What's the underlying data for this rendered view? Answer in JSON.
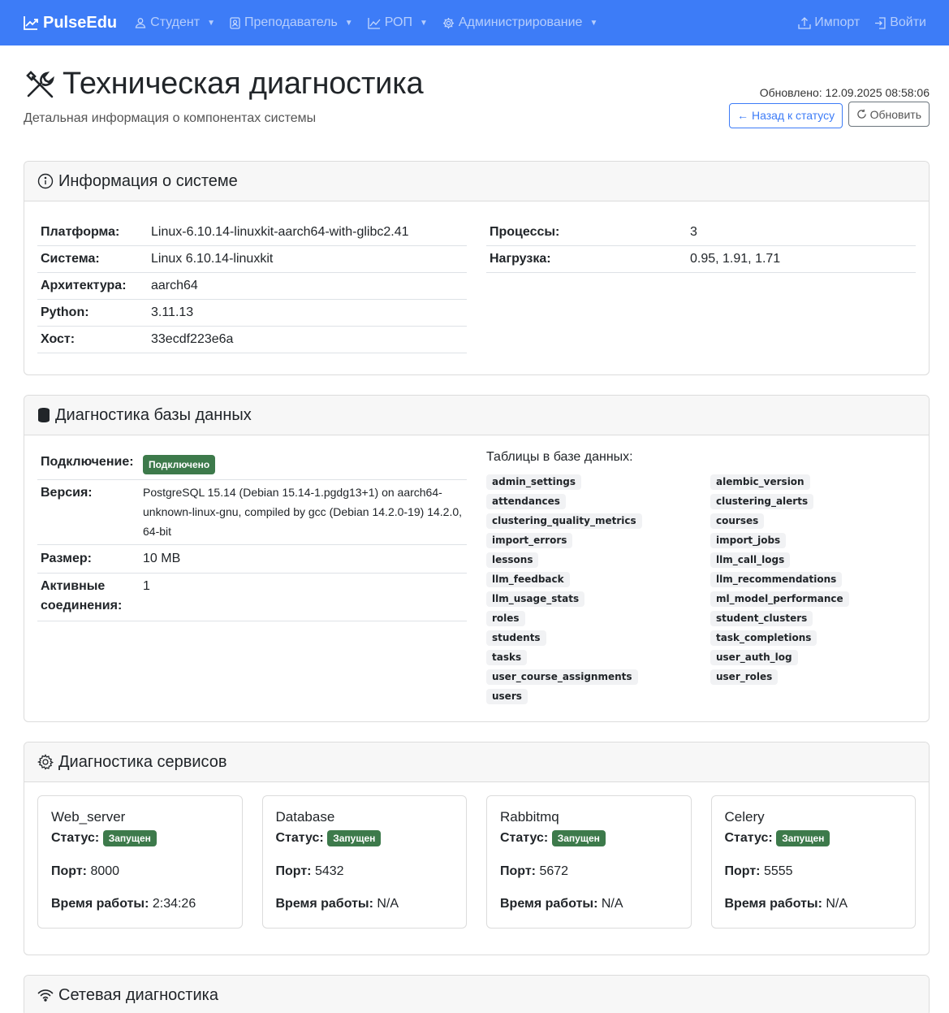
{
  "nav": {
    "brand": "PulseEdu",
    "items": [
      {
        "label": "Студент",
        "icon": "user-icon"
      },
      {
        "label": "Преподаватель",
        "icon": "id-badge-icon"
      },
      {
        "label": "РОП",
        "icon": "chart-line-icon"
      },
      {
        "label": "Администрирование",
        "icon": "gear-icon"
      }
    ],
    "import_label": "Импорт",
    "login_label": "Войти"
  },
  "header": {
    "title": "Техническая диагностика",
    "subtitle": "Детальная информация о компонентах системы",
    "updated": "Обновлено: 12.09.2025 08:58:06",
    "back_label": "Назад к статусу",
    "refresh_label": "Обновить"
  },
  "system": {
    "title": "Информация о системе",
    "left": [
      {
        "k": "Платформа:",
        "v": "Linux-6.10.14-linuxkit-aarch64-with-glibc2.41"
      },
      {
        "k": "Система:",
        "v": "Linux 6.10.14-linuxkit"
      },
      {
        "k": "Архитектура:",
        "v": "aarch64"
      },
      {
        "k": "Python:",
        "v": "3.11.13"
      },
      {
        "k": "Хост:",
        "v": "33ecdf223e6a"
      }
    ],
    "right": [
      {
        "k": "Процессы:",
        "v": "3"
      },
      {
        "k": "Нагрузка:",
        "v": "0.95, 1.91, 1.71"
      }
    ]
  },
  "database": {
    "title": "Диагностика базы данных",
    "connection_label": "Подключение:",
    "connection_status": "Подключено",
    "version_label": "Версия:",
    "version_value": "PostgreSQL 15.14 (Debian 15.14-1.pgdg13+1) on aarch64-unknown-linux-gnu, compiled by gcc (Debian 14.2.0-19) 14.2.0, 64-bit",
    "size_label": "Размер:",
    "size_value": "10 MB",
    "active_label": "Активные соединения:",
    "active_value": "1",
    "tables_title": "Таблицы в базе данных:",
    "tables": [
      "admin_settings",
      "alembic_version",
      "attendances",
      "clustering_alerts",
      "clustering_quality_metrics",
      "courses",
      "import_errors",
      "import_jobs",
      "lessons",
      "llm_call_logs",
      "llm_feedback",
      "llm_recommendations",
      "llm_usage_stats",
      "ml_model_performance",
      "roles",
      "student_clusters",
      "students",
      "task_completions",
      "tasks",
      "user_auth_log",
      "user_course_assignments",
      "user_roles",
      "users"
    ]
  },
  "services": {
    "title": "Диагностика сервисов",
    "status_label": "Статус:",
    "port_label": "Порт:",
    "uptime_label": "Время работы:",
    "items": [
      {
        "name": "Web_server",
        "status": "Запущен",
        "port": "8000",
        "uptime": "2:34:26"
      },
      {
        "name": "Database",
        "status": "Запущен",
        "port": "5432",
        "uptime": "N/A"
      },
      {
        "name": "Rabbitmq",
        "status": "Запущен",
        "port": "5672",
        "uptime": "N/A"
      },
      {
        "name": "Celery",
        "status": "Запущен",
        "port": "5555",
        "uptime": "N/A"
      }
    ]
  },
  "network": {
    "title": "Сетевая диагностика"
  }
}
